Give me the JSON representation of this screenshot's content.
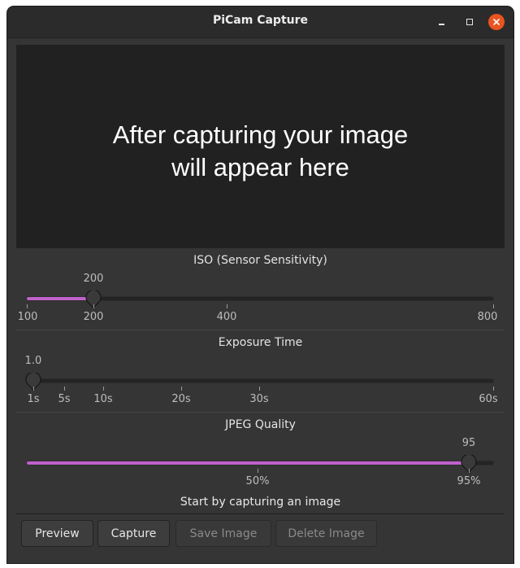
{
  "window": {
    "title": "PiCam Capture",
    "controls": [
      "minimize-icon",
      "maximize-icon",
      "close-icon"
    ],
    "close_color": "#e95420"
  },
  "preview": {
    "line1": "After capturing your image",
    "line2": "will appear here"
  },
  "iso": {
    "label": "ISO (Sensor Sensitivity)",
    "value_label": "200",
    "value": 200,
    "min": 100,
    "max": 800,
    "ticks": [
      "100",
      "200",
      "400",
      "800"
    ]
  },
  "exposure": {
    "label": "Exposure Time",
    "value_label": "1.0",
    "value": 1.0,
    "ticks": [
      "1s",
      "5s",
      "10s",
      "20s",
      "30s",
      "60s"
    ]
  },
  "jpeg": {
    "label": "JPEG Quality",
    "value_label": "95",
    "value": 95,
    "ticks": [
      "50%",
      "95%"
    ]
  },
  "status": "Start by capturing an image",
  "buttons": {
    "preview": "Preview",
    "capture": "Capture",
    "save": "Save Image",
    "delete": "Delete Image"
  },
  "colors": {
    "accent": "#c061cb",
    "window_bg": "#353535",
    "preview_bg": "#212121"
  }
}
